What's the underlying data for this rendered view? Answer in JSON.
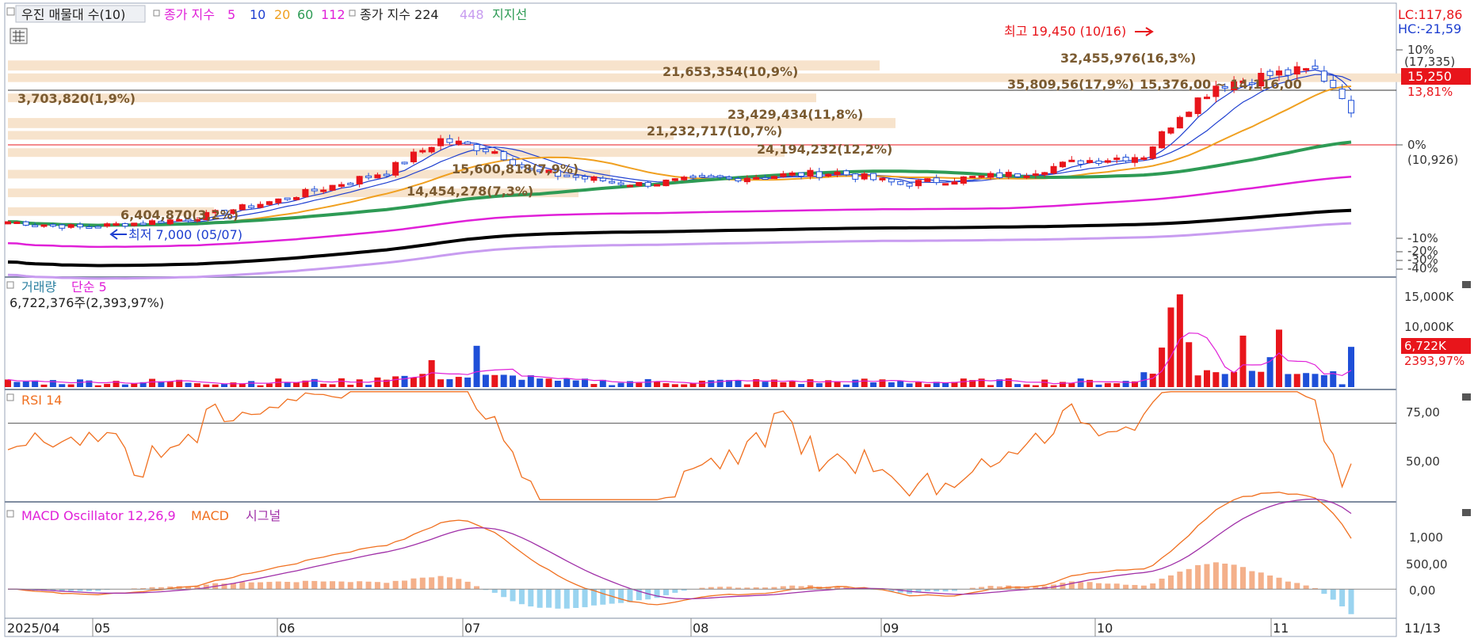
{
  "toolbar": {
    "checkbox_label": "우진 매물대 수(10)",
    "close_ma_label": "종가 지수",
    "close_ma_periods": [
      "5",
      "10",
      "20",
      "60",
      "112"
    ],
    "long_ma_label": "종가 지수 224",
    "long_ma_extra": "448",
    "support_label": "지지선"
  },
  "price_panel": {
    "lc_label": "LC:117,86",
    "hc_label": "HC:-21,59",
    "current_price": "15,250",
    "current_pct": "13,81%",
    "high_annotation": "최고 19,450 (10/16)",
    "low_annotation": "최저 7,000 (05/07)",
    "axis_ticks": [
      "10%",
      "(17,335)",
      "0%",
      "(10,926)",
      "-10%",
      "-20%",
      "-30%",
      "-40%"
    ],
    "volume_profile": [
      "21,653,354(10,9%)",
      "3,703,820(1,9%)",
      "23,429,434(11,8%)",
      "21,232,717(10,7%)",
      "24,194,232(12,2%)",
      "15,600,818(7,9%)",
      "14,454,278(7,3%)",
      "32,455,976(16,3%)",
      "35,809,56(17,9%)",
      "6,404,870(3,2%)"
    ],
    "range_label": "15,376,00 ~ 14,116,00"
  },
  "volume_panel": {
    "title": "거래량",
    "ma_label": "단순 5",
    "summary": "6,722,376주(2,393,97%)",
    "axis_ticks": [
      "15,000K",
      "10,000K"
    ],
    "current_value": "6,722K",
    "current_pct": "2393,97%"
  },
  "rsi_panel": {
    "title": "RSI 14",
    "axis_ticks": [
      "75,00",
      "50,00"
    ]
  },
  "macd_panel": {
    "title_osc": "MACD Oscillator 12,26,9",
    "title_macd": "MACD",
    "title_signal": "시그널",
    "axis_ticks": [
      "1,000",
      "500,00",
      "0,00"
    ]
  },
  "x_axis": {
    "labels": [
      "2025/04",
      "05",
      "06",
      "07",
      "08",
      "09",
      "10",
      "11"
    ],
    "end_label": "11/13"
  },
  "colors": {
    "up": "#e8151b",
    "down": "#1e4fd8",
    "ma5": "#1e3fd0",
    "ma20": "#f0a020",
    "ma60": "#2e9b55",
    "ma112": "#e020d8",
    "ma224": "#000000",
    "ma448": "#c89cf0",
    "rsi": "#f07020",
    "macd": "#f07020",
    "signal": "#a030a8",
    "osc_pos": "#f4b08a",
    "osc_neg": "#9ad4f0",
    "profile": "#f7e3cc"
  },
  "chart_data": [
    {
      "type": "candlestick",
      "title": "",
      "x": [
        "2025/04",
        "05",
        "06",
        "07",
        "08",
        "09",
        "10",
        "11"
      ],
      "price_range": [
        7000,
        19450
      ],
      "high": {
        "value": 19450,
        "date": "10/16"
      },
      "low": {
        "value": 7000,
        "date": "05/07"
      },
      "last_close": 15250,
      "axis_pct_range": [
        -40,
        12
      ],
      "moving_averages": [
        "5",
        "10",
        "20",
        "60",
        "112",
        "224",
        "448"
      ],
      "legend": "top-left"
    },
    {
      "type": "bar",
      "title": "거래량",
      "last_value_k": 6722,
      "ylim": [
        0,
        16000
      ],
      "unit": "K"
    },
    {
      "type": "line",
      "title": "RSI 14",
      "ylim": [
        35,
        85
      ],
      "last_value": 52
    },
    {
      "type": "line",
      "title": "MACD Oscillator 12,26,9",
      "series": [
        {
          "name": "MACD"
        },
        {
          "name": "시그널"
        }
      ],
      "ylim": [
        -500,
        1500
      ]
    }
  ]
}
